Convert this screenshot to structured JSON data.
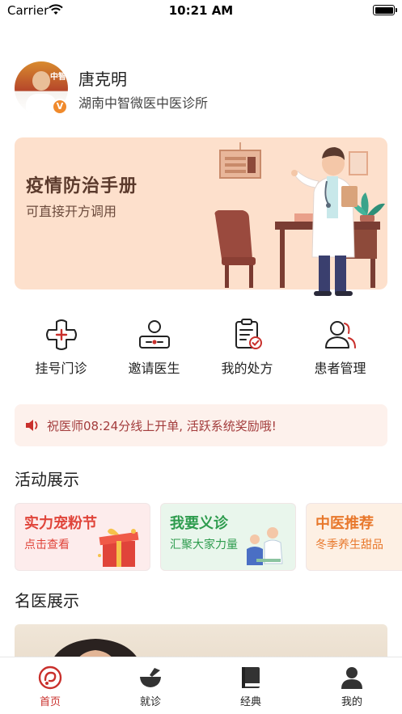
{
  "status_bar": {
    "carrier": "Carrier",
    "time": "10:21 AM"
  },
  "profile": {
    "name": "唐克明",
    "clinic": "湖南中智微医中医诊所",
    "badge": "V",
    "avatar_text": "中智"
  },
  "banner": {
    "title": "疫情防治手册",
    "subtitle": "可直接开方调用"
  },
  "menu": [
    {
      "label": "挂号门诊",
      "icon": "plus-flower-icon"
    },
    {
      "label": "邀请医生",
      "icon": "doctor-invite-icon"
    },
    {
      "label": "我的处方",
      "icon": "prescription-icon"
    },
    {
      "label": "患者管理",
      "icon": "patients-icon"
    }
  ],
  "notice": {
    "text": "祝医师08:24分线上开单, 活跃系统奖励哦!",
    "icon": "speaker-icon"
  },
  "activities": {
    "title": "活动展示",
    "cards": [
      {
        "title": "实力宠粉节",
        "subtitle": "点击查看",
        "title_color": "#e0443a",
        "subtitle_color": "#e0443a",
        "bg": "#fdecec"
      },
      {
        "title": "我要义诊",
        "subtitle": "汇聚大家力量",
        "title_color": "#2e9c4e",
        "subtitle_color": "#2e9c4e",
        "bg": "#e9f6ec"
      },
      {
        "title": "中医推荐",
        "subtitle": "冬季养生甜品",
        "title_color": "#e8782c",
        "subtitle_color": "#e8782c",
        "bg": "#fdf0e4"
      }
    ]
  },
  "famous_doctors": {
    "title": "名医展示"
  },
  "tabbar": [
    {
      "label": "首页",
      "icon": "home-logo-icon",
      "active": true
    },
    {
      "label": "就诊",
      "icon": "mortar-icon",
      "active": false
    },
    {
      "label": "经典",
      "icon": "book-icon",
      "active": false
    },
    {
      "label": "我的",
      "icon": "user-icon",
      "active": false
    }
  ],
  "colors": {
    "accent": "#c9302c",
    "banner_bg": "#fde0cc",
    "notice_text": "#a33c3c"
  }
}
